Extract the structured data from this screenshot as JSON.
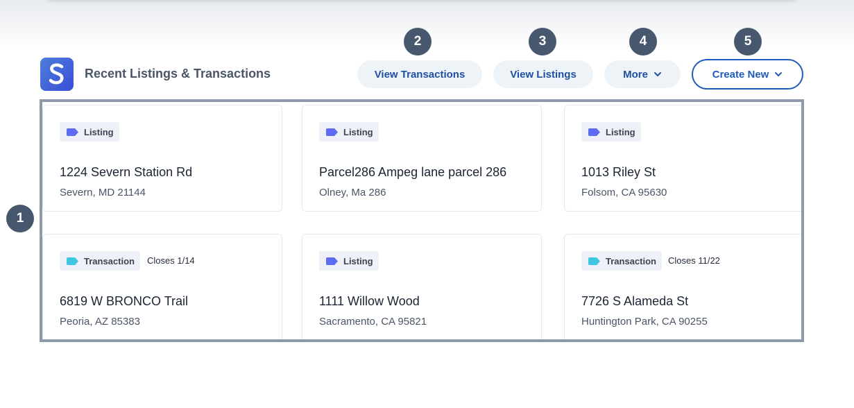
{
  "header": {
    "title": "Recent Listings & Transactions",
    "buttons": {
      "view_transactions": "View Transactions",
      "view_listings": "View Listings",
      "more": "More",
      "create_new": "Create New"
    }
  },
  "markers": [
    "1",
    "2",
    "3",
    "4",
    "5"
  ],
  "colors": {
    "listing_tag": "#5d6cf0",
    "transaction_tag": "#3ec7df",
    "accent": "#1f5bb8",
    "marker": "#47586e"
  },
  "cards": [
    {
      "tag": "Listing",
      "closes": "",
      "address": "1224 Severn Station Rd",
      "city": "Severn, MD 21144"
    },
    {
      "tag": "Listing",
      "closes": "",
      "address": "Parcel286 Ampeg lane parcel 286",
      "city": "Olney, Ma 286"
    },
    {
      "tag": "Listing",
      "closes": "",
      "address": "1013 Riley St",
      "city": "Folsom, CA 95630"
    },
    {
      "tag": "Transaction",
      "closes": "Closes 1/14",
      "address": "6819 W BRONCO Trail",
      "city": "Peoria, AZ 85383"
    },
    {
      "tag": "Listing",
      "closes": "",
      "address": "1111 Willow Wood",
      "city": "Sacramento, CA 95821"
    },
    {
      "tag": "Transaction",
      "closes": "Closes 11/22",
      "address": "7726 S Alameda St",
      "city": "Huntington Park, CA 90255"
    }
  ]
}
